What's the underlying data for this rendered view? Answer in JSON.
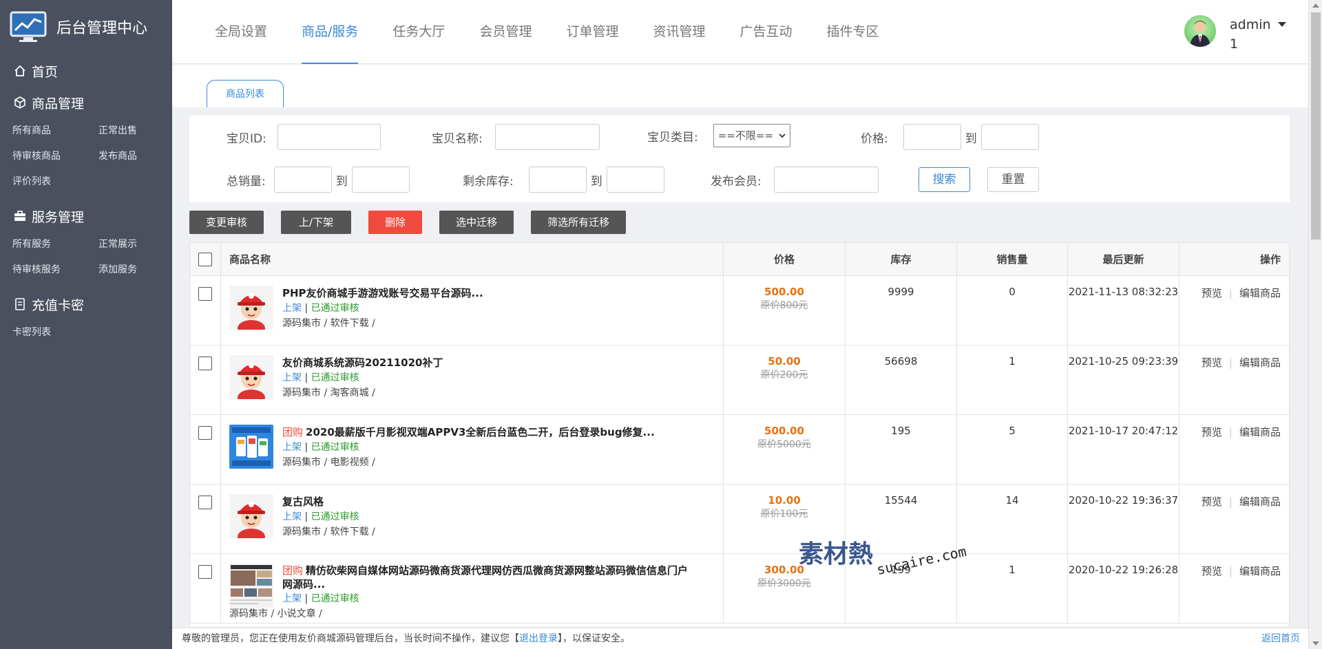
{
  "brand": {
    "title": "后台管理中心",
    "logo_icon": "chart-monitor-icon"
  },
  "sidebar": {
    "home": {
      "label": "首页",
      "icon": "home-icon"
    },
    "sections": [
      {
        "label": "商品管理",
        "icon": "cube-icon",
        "items": [
          "所有商品",
          "正常出售",
          "待审核商品",
          "发布商品",
          "评价列表"
        ]
      },
      {
        "label": "服务管理",
        "icon": "briefcase-icon",
        "items": [
          "所有服务",
          "正常展示",
          "待审核服务",
          "添加服务"
        ]
      },
      {
        "label": "充值卡密",
        "icon": "document-icon",
        "items": [
          "卡密列表"
        ]
      }
    ]
  },
  "topnav": {
    "items": [
      "全局设置",
      "商品/服务",
      "任务大厅",
      "会员管理",
      "订单管理",
      "资讯管理",
      "广告互动",
      "插件专区"
    ],
    "active": "商品/服务"
  },
  "user": {
    "name_line1": "admin",
    "name_line2": "1"
  },
  "tab": {
    "label": "商品列表"
  },
  "filter": {
    "id_label": "宝贝ID:",
    "name_label": "宝贝名称:",
    "category_label": "宝贝类目:",
    "category_value": "==不限==",
    "price_label": "价格:",
    "to": "到",
    "sales_label": "总销量:",
    "stock_label": "剩余库存:",
    "member_label": "发布会员:",
    "search_label": "搜索",
    "reset_label": "重置"
  },
  "actions": [
    "变更审核",
    "上/下架",
    "删除",
    "选中迁移",
    "筛选所有迁移"
  ],
  "table": {
    "headers": {
      "name": "商品名称",
      "price": "价格",
      "stock": "库存",
      "sales": "销售量",
      "updated": "最后更新",
      "ops": "操作"
    },
    "status_sep": " | ",
    "op_preview": "预览",
    "op_edit": "编辑商品",
    "rows": [
      {
        "tag": "",
        "title": "PHP友价商城手游游戏账号交易平台源码...",
        "title2": "",
        "status1": "上架",
        "status2": "已通过审核",
        "cats": "源码集市 / 软件下载 /",
        "price": "500.00",
        "oprice": "原价800元",
        "stock": "9999",
        "sales": "0",
        "updated": "2021-11-13 08:32:23",
        "thumb": "mascot"
      },
      {
        "tag": "",
        "title": "友价商城系统源码20211020补丁",
        "title2": "",
        "status1": "上架",
        "status2": "已通过审核",
        "cats": "源码集市 / 淘客商城 /",
        "price": "50.00",
        "oprice": "原价200元",
        "stock": "56698",
        "sales": "1",
        "updated": "2021-10-25 09:23:39",
        "thumb": "mascot"
      },
      {
        "tag": "团购",
        "title": "2020最薪版千月影视双端APPV3全新后台蓝色二开，后台登录bug修复...",
        "title2": "",
        "status1": "上架",
        "status2": "已通过审核",
        "cats": "源码集市 / 电影视频 /",
        "price": "500.00",
        "oprice": "原价5000元",
        "stock": "195",
        "sales": "5",
        "updated": "2021-10-17 20:47:12",
        "thumb": "app"
      },
      {
        "tag": "",
        "title": "复古风格",
        "title2": "",
        "status1": "上架",
        "status2": "已通过审核",
        "cats": "源码集市 / 软件下载 /",
        "price": "10.00",
        "oprice": "原价100元",
        "stock": "15544",
        "sales": "14",
        "updated": "2020-10-22 19:36:37",
        "thumb": "mascot"
      },
      {
        "tag": "团购",
        "title": "精仿砍柴网自媒体网站源码微商货源代理网仿西瓜微商货源网整站源码微信信息门户",
        "title2": "网源码...",
        "status1": "上架",
        "status2": "已通过审核",
        "cats": "源码集市 / 小说文章 /",
        "price": "300.00",
        "oprice": "原价3000元",
        "stock": "199",
        "sales": "1",
        "updated": "2020-10-22 19:26:28",
        "thumb": "web"
      }
    ]
  },
  "footer": {
    "text_before": "尊敬的管理员，您正在使用友价商城源码管理后台，当长时间不操作，建议您【",
    "logout": "退出登录",
    "text_after": "】，以保证安全。",
    "home_link": "返回首页"
  },
  "watermark": {
    "text_cn": "素材熱",
    "text_en": "sucaire.com"
  },
  "colors": {
    "sidebar_bg": "#4b505f",
    "accent": "#3a8ad6",
    "danger": "#f04a3e",
    "price": "#e8700f",
    "approved": "#2a9a2a"
  }
}
